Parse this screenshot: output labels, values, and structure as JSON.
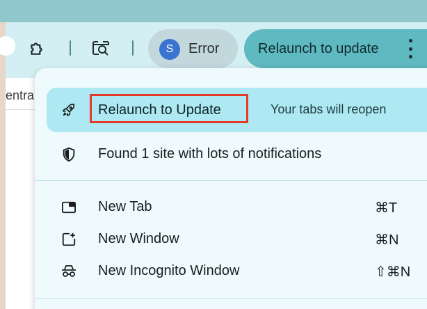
{
  "toolbar": {
    "profile_initial": "S",
    "profile_status": "Error",
    "relaunch_chip_label": "Relaunch to update",
    "icons": [
      "extensions-icon",
      "tab-search-icon",
      "more-vert-icon"
    ]
  },
  "page": {
    "partial_text": "entra"
  },
  "menu": {
    "update_item": {
      "label": "Relaunch to Update",
      "sublabel": "Your tabs will reopen",
      "icon": "rocket-icon"
    },
    "notifications_item": {
      "label": "Found 1 site with lots of notifications",
      "icon": "shield-icon"
    },
    "items": [
      {
        "label": "New Tab",
        "shortcut": "⌘T",
        "icon": "new-tab-icon"
      },
      {
        "label": "New Window",
        "shortcut": "⌘N",
        "icon": "new-window-icon"
      },
      {
        "label": "New Incognito Window",
        "shortcut": "⇧⌘N",
        "icon": "incognito-icon"
      }
    ]
  },
  "colors": {
    "accent": "#5fb9c0",
    "highlight": "#aee9f3",
    "annotation": "#e33a2a",
    "avatar": "#3b73d1"
  }
}
